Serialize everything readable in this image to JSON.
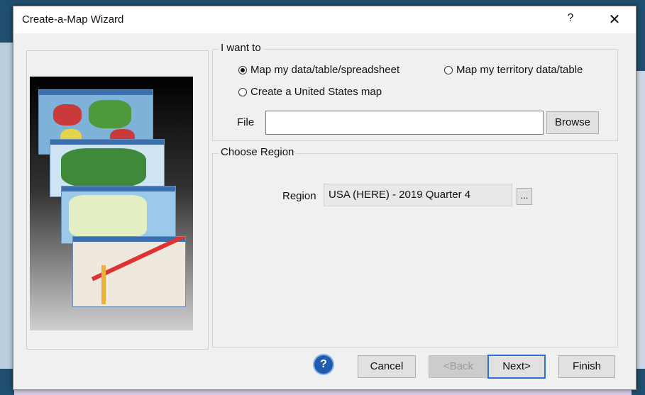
{
  "window": {
    "title": "Create-a-Map Wizard",
    "help_glyph": "?",
    "close_glyph": "✕"
  },
  "i_want_to": {
    "label": "I want to",
    "options": [
      {
        "label": "Map my data/table/spreadsheet",
        "selected": true
      },
      {
        "label": "Map my territory data/table",
        "selected": false
      },
      {
        "label": "Create a United States map",
        "selected": false
      }
    ],
    "file_label": "File",
    "file_value": "",
    "browse_label": "Browse"
  },
  "choose_region": {
    "label": "Choose Region",
    "region_label": "Region",
    "region_value": "USA (HERE) - 2019 Quarter 4",
    "ellipsis_label": "..."
  },
  "footer": {
    "help_icon": "question-circle-icon",
    "cancel_label": "Cancel",
    "back_label": "<Back",
    "next_label": "Next>",
    "finish_label": "Finish"
  },
  "colors": {
    "accent": "#2f6fcf",
    "dialog_bg": "#f0f0f0",
    "desktop_bg": "#1f4e6e"
  }
}
